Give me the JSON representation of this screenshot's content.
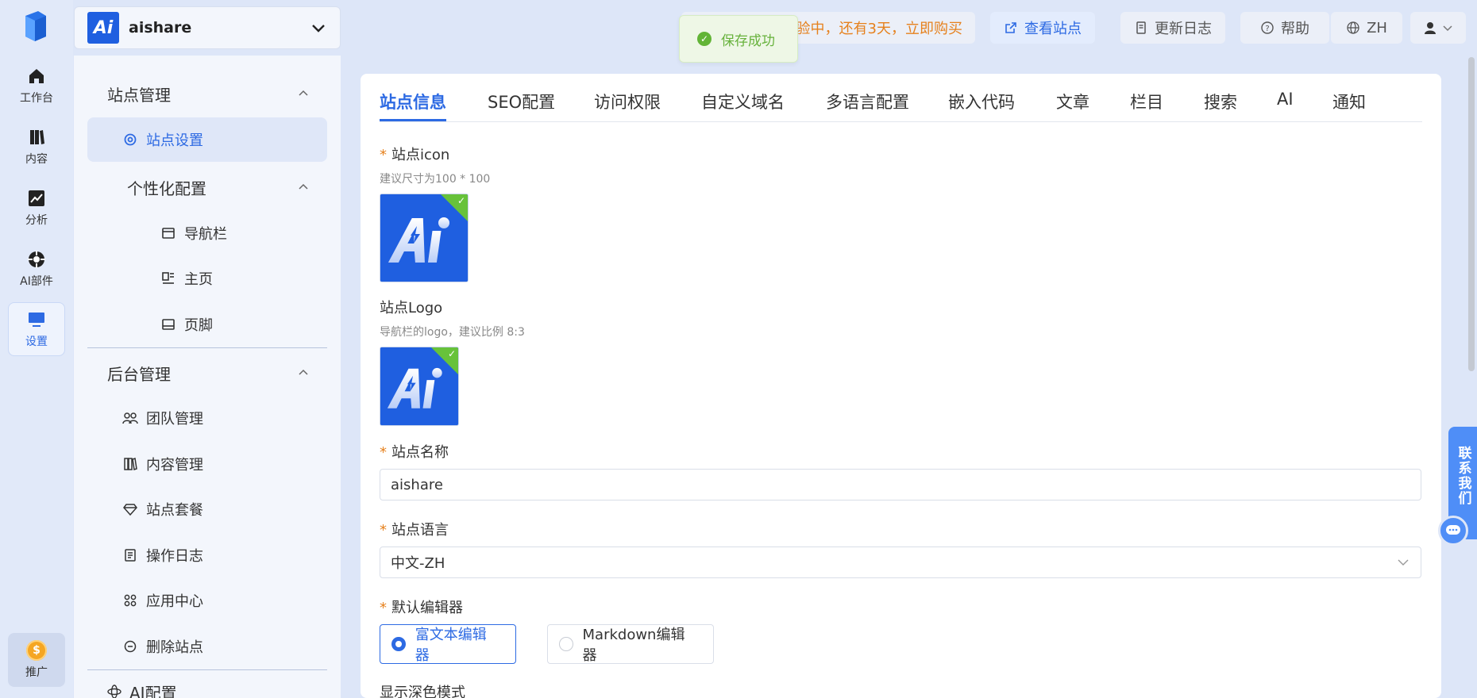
{
  "app": {
    "site_name": "aishare",
    "site_badge": "Ai"
  },
  "rail": {
    "items": [
      {
        "label": "工作台",
        "icon": "home-icon"
      },
      {
        "label": "内容",
        "icon": "book-icon"
      },
      {
        "label": "分析",
        "icon": "chart-icon"
      },
      {
        "label": "AI部件",
        "icon": "ai-widget-icon"
      },
      {
        "label": "设置",
        "icon": "monitor-icon",
        "active": true
      }
    ],
    "promo": {
      "label": "推广",
      "icon": "coin-icon",
      "coin_symbol": "$"
    }
  },
  "sidebar": {
    "group_site": "站点管理",
    "site_settings": "站点设置",
    "group_personal": "个性化配置",
    "navbar": "导航栏",
    "home": "主页",
    "footer": "页脚",
    "group_admin": "后台管理",
    "team": "团队管理",
    "content": "内容管理",
    "plan": "站点套餐",
    "oplog": "操作日志",
    "apps": "应用中心",
    "delete": "删除站点",
    "ai_config": "AI配置"
  },
  "header": {
    "trial_text": "验中，还有3天，立即购买",
    "view_site": "查看站点",
    "changelog": "更新日志",
    "help": "帮助",
    "lang": "ZH"
  },
  "toast": {
    "text": "保存成功"
  },
  "tabs": [
    "站点信息",
    "SEO配置",
    "访问权限",
    "自定义域名",
    "多语言配置",
    "嵌入代码",
    "文章",
    "栏目",
    "搜索",
    "AI",
    "通知"
  ],
  "form": {
    "icon_label": "站点icon",
    "icon_hint": "建议尺寸为100 * 100",
    "logo_label": "站点Logo",
    "logo_hint": "导航栏的logo，建议比例 8:3",
    "name_label": "站点名称",
    "name_value": "aishare",
    "lang_label": "站点语言",
    "lang_value": "中文-ZH",
    "editor_label": "默认编辑器",
    "editor_rich": "富文本编辑器",
    "editor_md": "Markdown编辑器",
    "dark_label": "显示深色模式",
    "required_mark": "*"
  },
  "float": {
    "contact": "联系我们"
  },
  "colors": {
    "accent": "#2d6ae3",
    "trial": "#e6811d",
    "success": "#67b23c",
    "logo_blue": "#1f5fe0"
  }
}
